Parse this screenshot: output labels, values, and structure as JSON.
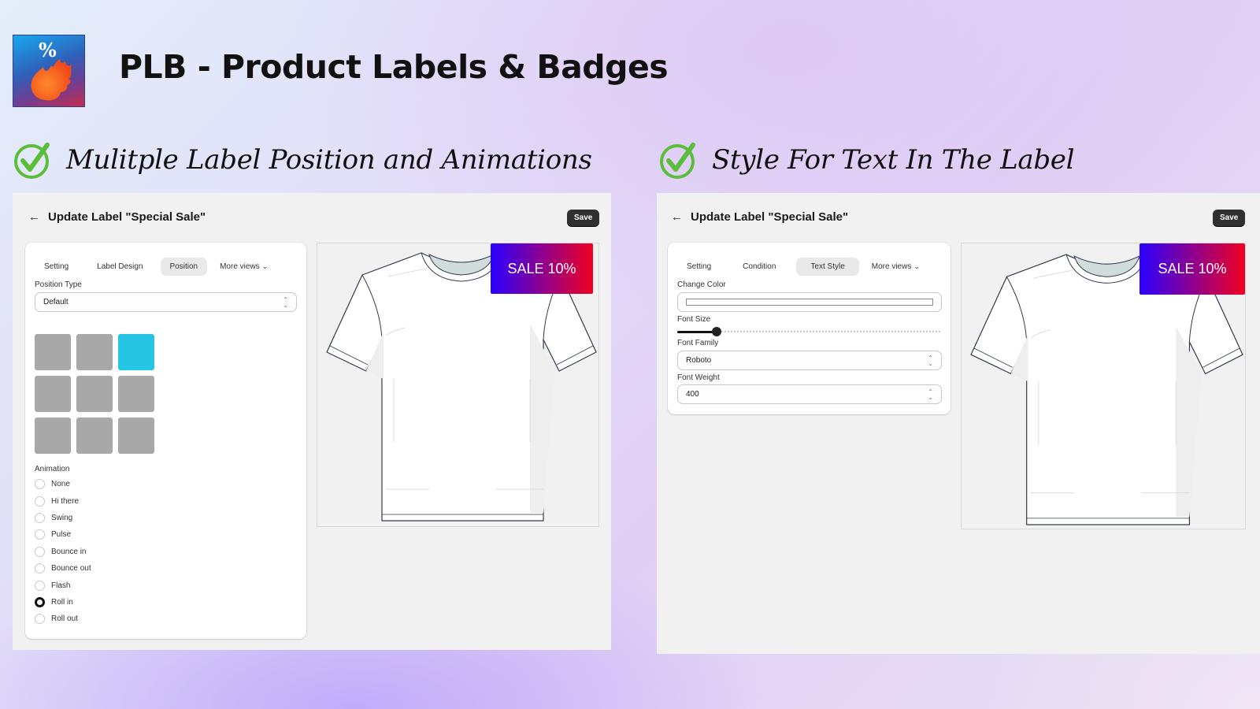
{
  "app": {
    "title": "PLB - Product Labels & Badges",
    "logo_symbol": "%",
    "logo_icon": "flame-icon"
  },
  "colors": {
    "check_green": "#5bbd3a",
    "selected_position": "#25c5e3",
    "position_default": "#a8a8a8",
    "badge_gradient_start": "#2a00ff",
    "badge_gradient_end": "#f00020",
    "save_button": "#303030"
  },
  "features": [
    {
      "heading": "Mulitple Label Position and Animations",
      "icon": "check-circle-icon",
      "panel": {
        "back_icon": "arrow-left-icon",
        "title": "Update Label \"Special Sale\"",
        "save_label": "Save",
        "tabs": [
          {
            "label": "Setting",
            "active": false
          },
          {
            "label": "Label Design",
            "active": false
          },
          {
            "label": "Position",
            "active": true
          },
          {
            "label": "More views",
            "active": false,
            "icon": "chevron-down-icon"
          }
        ],
        "position_type_label": "Position Type",
        "position_type_value": "Default",
        "position_grid": {
          "rows": 3,
          "cols": 3,
          "selected": {
            "row": 1,
            "col": 3
          }
        },
        "animation_label": "Animation",
        "animations": [
          {
            "label": "None",
            "checked": false
          },
          {
            "label": "Hi there",
            "checked": false
          },
          {
            "label": "Swing",
            "checked": false
          },
          {
            "label": "Pulse",
            "checked": false
          },
          {
            "label": "Bounce in",
            "checked": false
          },
          {
            "label": "Bounce out",
            "checked": false
          },
          {
            "label": "Flash",
            "checked": false
          },
          {
            "label": "Roll in",
            "checked": true
          },
          {
            "label": "Roll out",
            "checked": false
          }
        ],
        "badge_text": "SALE 10%"
      }
    },
    {
      "heading": "Style For Text In The Label",
      "icon": "check-circle-icon",
      "panel": {
        "back_icon": "arrow-left-icon",
        "title": "Update Label \"Special Sale\"",
        "save_label": "Save",
        "tabs": [
          {
            "label": "Setting",
            "active": false
          },
          {
            "label": "Condition",
            "active": false
          },
          {
            "label": "Text Style",
            "active": true
          },
          {
            "label": "More views",
            "active": false,
            "icon": "chevron-down-icon"
          }
        ],
        "change_color_label": "Change Color",
        "change_color_value": "#ffffff",
        "font_size_label": "Font Size",
        "font_size_fraction": 0.15,
        "font_family_label": "Font Family",
        "font_family_value": "Roboto",
        "font_weight_label": "Font Weight",
        "font_weight_value": "400",
        "badge_text": "SALE 10%"
      }
    }
  ]
}
